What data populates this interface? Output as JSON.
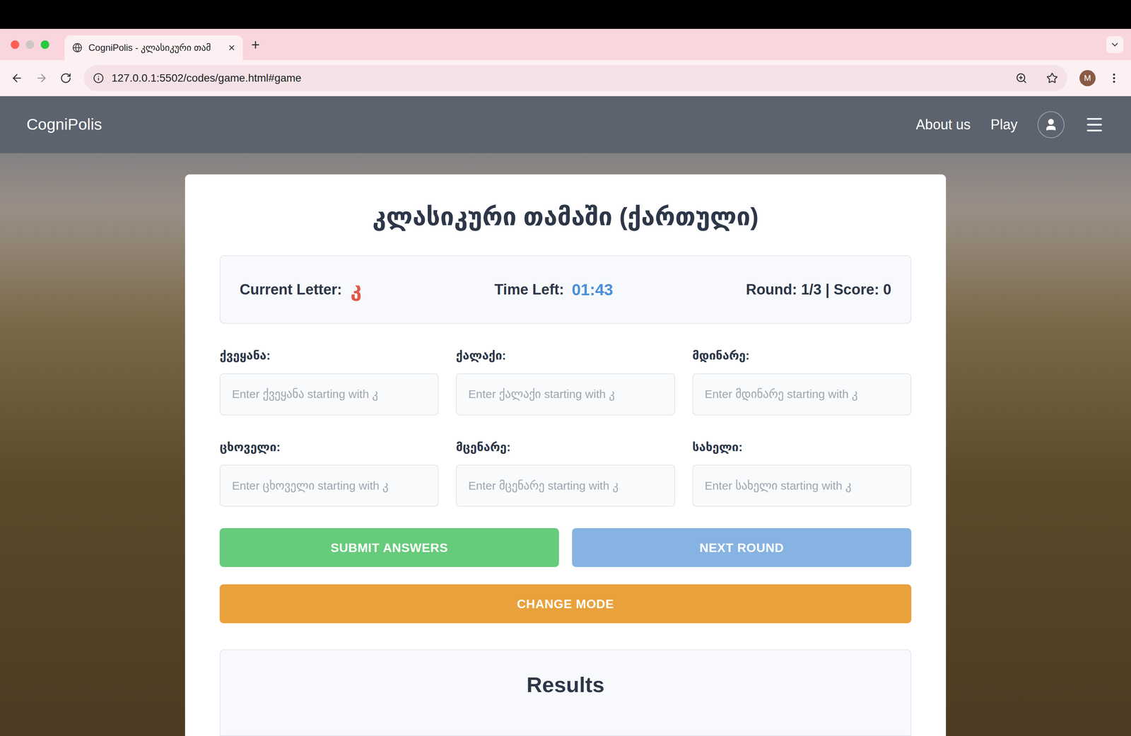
{
  "browser": {
    "tab": {
      "title": "CogniPolis - კლასიკური თამ",
      "close": "×",
      "selected": true
    },
    "new_tab": "+",
    "url": "127.0.0.1:5502/codes/game.html#game",
    "profile": "M"
  },
  "nav": {
    "brand": "CogniPolis",
    "links": [
      {
        "label": "About us"
      },
      {
        "label": "Play"
      }
    ]
  },
  "game": {
    "title": "კლასიკური თამაში (ქართული)",
    "status": {
      "letter_label": "Current Letter:",
      "letter": "კ",
      "time_label": "Time Left:",
      "time": "01:43",
      "round_score": "Round: 1/3 | Score: 0"
    },
    "fields": [
      {
        "label": "ქვეყანა:",
        "placeholder": "Enter ქვეყანა starting with კ"
      },
      {
        "label": "ქალაქი:",
        "placeholder": "Enter ქალაქი starting with კ"
      },
      {
        "label": "მდინარე:",
        "placeholder": "Enter მდინარე starting with კ"
      },
      {
        "label": "ცხოველი:",
        "placeholder": "Enter ცხოველი starting with კ"
      },
      {
        "label": "მცენარე:",
        "placeholder": "Enter მცენარე starting with კ"
      },
      {
        "label": "სახელი:",
        "placeholder": "Enter სახელი starting with კ"
      }
    ],
    "buttons": [
      {
        "label": "SUBMIT ANSWERS",
        "color": "#66cb7a"
      },
      {
        "label": "NEXT ROUND",
        "color": "#86b3e1"
      }
    ],
    "wide_button": {
      "label": "CHANGE MODE",
      "color": "#e9a13b"
    },
    "results": {
      "title": "Results"
    }
  }
}
